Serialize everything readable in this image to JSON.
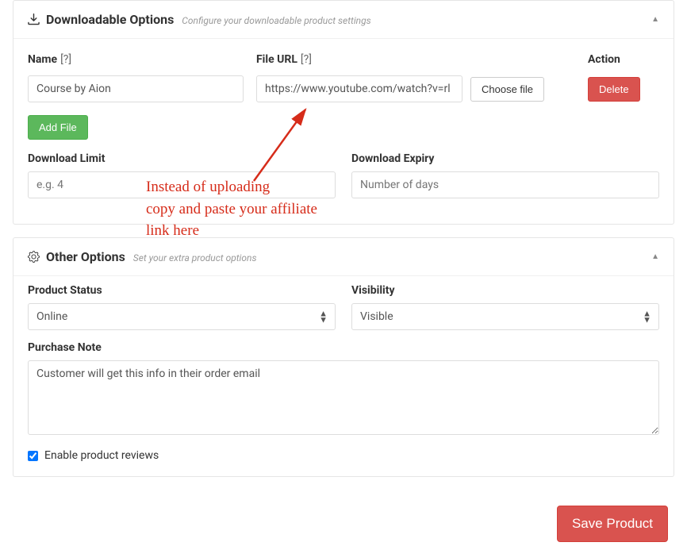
{
  "downloadable": {
    "title": "Downloadable Options",
    "subtitle": "Configure your downloadable product settings",
    "columns": {
      "name": "Name",
      "file": "File URL",
      "action": "Action"
    },
    "help_marker": "[?]",
    "rows": [
      {
        "name_value": "Course by Aion",
        "file_url_value": "https://www.youtube.com/watch?v=rl",
        "choose_label": "Choose file",
        "delete_label": "Delete"
      }
    ],
    "add_file_label": "Add File",
    "download_limit": {
      "label": "Download Limit",
      "placeholder": "e.g. 4",
      "value": ""
    },
    "download_expiry": {
      "label": "Download Expiry",
      "placeholder": "Number of days",
      "value": ""
    }
  },
  "other": {
    "title": "Other Options",
    "subtitle": "Set your extra product options",
    "product_status": {
      "label": "Product Status",
      "value": "Online"
    },
    "visibility": {
      "label": "Visibility",
      "value": "Visible"
    },
    "purchase_note": {
      "label": "Purchase Note",
      "value": "Customer will get this info in their order email"
    },
    "enable_reviews": {
      "label": "Enable product reviews",
      "checked": true
    }
  },
  "footer": {
    "save_label": "Save Product"
  },
  "annotation": {
    "line1": "Instead of uploading",
    "line2": "copy and paste your affiliate",
    "line3": "link here"
  },
  "colors": {
    "danger": "#d9534f",
    "success": "#5cb85c",
    "annotation": "#d62c1a"
  }
}
